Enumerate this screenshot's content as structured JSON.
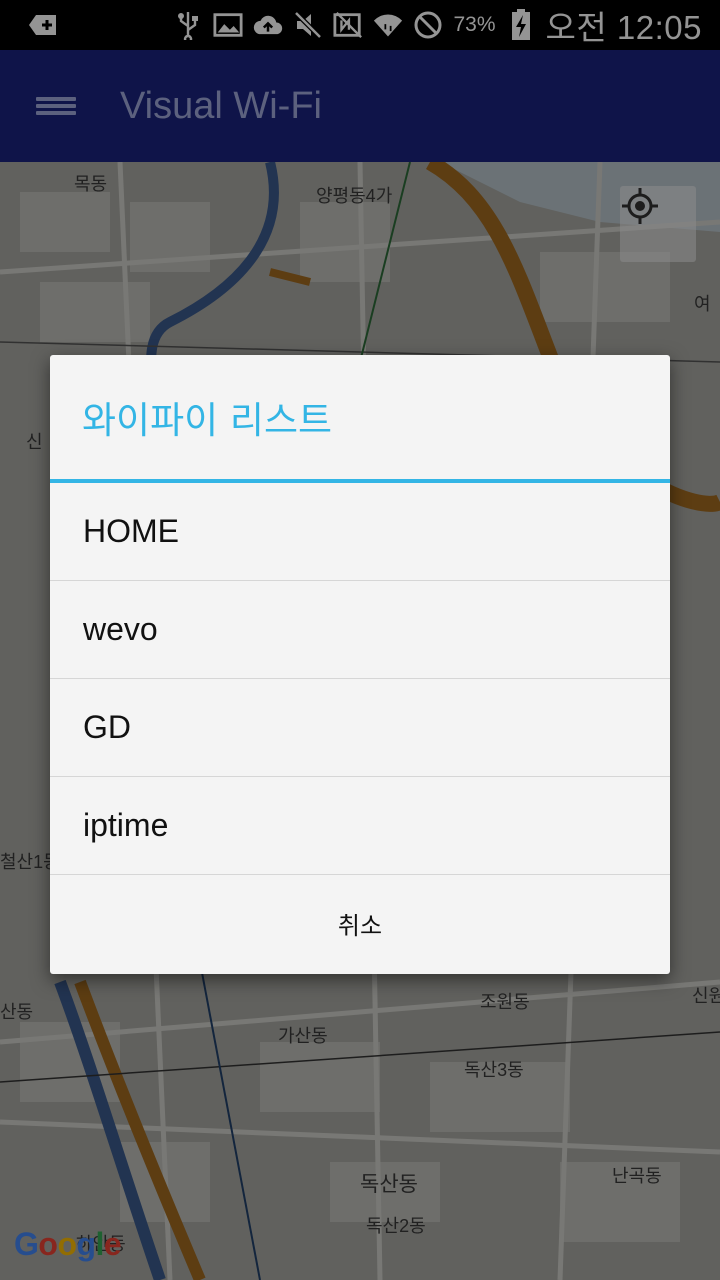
{
  "status_bar": {
    "battery_percent": "73%",
    "time": "오전 12:05"
  },
  "app_bar": {
    "title": "Visual Wi-Fi"
  },
  "map": {
    "labels": [
      "목동",
      "양평동4가",
      "여",
      "신",
      "조원동",
      "신원",
      "가산동",
      "독산3동",
      "난곡동",
      "독산동",
      "독산2동",
      "철산1동",
      "산동",
      "하안동"
    ],
    "attribution": "Google"
  },
  "dialog": {
    "title": "와이파이 리스트",
    "items": [
      "HOME",
      "wevo",
      "GD",
      "iptime"
    ],
    "cancel_label": "취소"
  },
  "colors": {
    "app_bar": "#1a237e",
    "dialog_accent": "#33b5e5",
    "dialog_background": "#f4f4f4"
  }
}
